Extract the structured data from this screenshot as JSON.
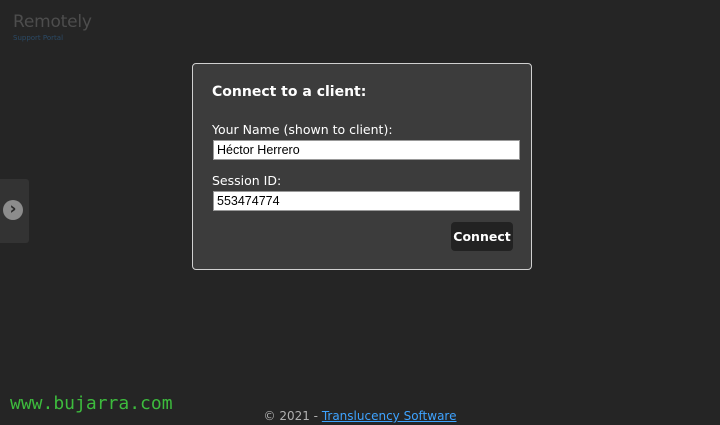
{
  "app": {
    "title": "Remotely",
    "subtitle": "Support Portal"
  },
  "side_handle": {
    "icon": "chevron-right-icon",
    "glyph": "›"
  },
  "dialog": {
    "title": "Connect to a client:",
    "name_label": "Your Name (shown to client):",
    "name_value": "Héctor Herrero",
    "session_label": "Session ID:",
    "session_value": "553474774",
    "connect_label": "Connect"
  },
  "footer": {
    "prefix": "© 2021 - ",
    "link_text": "Translucency Software"
  },
  "watermark": {
    "text": "www.bujarra.com"
  },
  "colors": {
    "background": "#252525",
    "dialog_bg": "#3c3c3c",
    "link": "#3ea3ff",
    "watermark": "#3dbb3d"
  }
}
